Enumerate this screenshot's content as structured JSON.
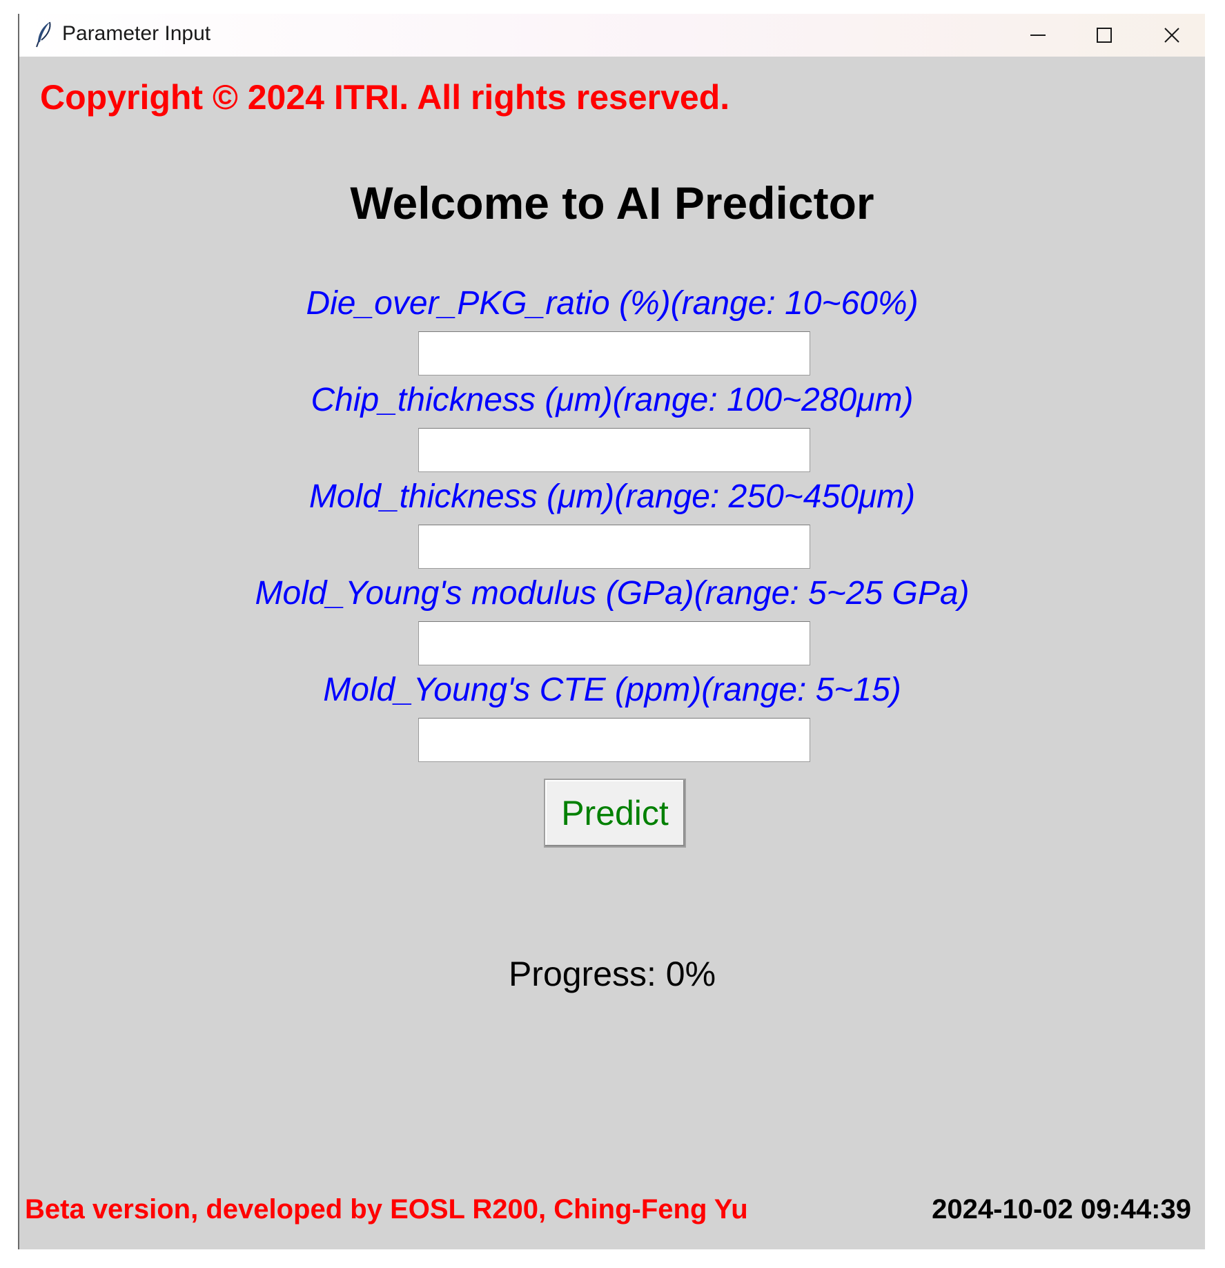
{
  "window": {
    "title": "Parameter Input",
    "icon": "feather-icon",
    "controls": [
      "minimize-icon",
      "maximize-icon",
      "close-icon"
    ]
  },
  "header": {
    "copyright": "Copyright © 2024 ITRI. All rights reserved.",
    "welcome": "Welcome to AI Predictor"
  },
  "parameters": [
    {
      "label": "Die_over_PKG_ratio (%)(range: 10~60%)",
      "value": ""
    },
    {
      "label": "Chip_thickness (μm)(range: 100~280μm)",
      "value": ""
    },
    {
      "label": "Mold_thickness (μm)(range: 250~450μm)",
      "value": ""
    },
    {
      "label": "Mold_Young's modulus (GPa)(range: 5~25 GPa)",
      "value": ""
    },
    {
      "label": "Mold_Young's CTE (ppm)(range: 5~15)",
      "value": ""
    }
  ],
  "predict_button": {
    "label": "Predict"
  },
  "progress": {
    "text": "Progress: 0%",
    "value": 0
  },
  "footer": {
    "credit": "Beta version, developed by EOSL R200, Ching-Feng Yu",
    "timestamp": "2024-10-02 09:44:39"
  },
  "colors": {
    "background": "#d3d3d3",
    "copyright": "#ff0000",
    "param_label": "#0000ff",
    "predict_text": "#008000",
    "footer_credit": "#ff0000"
  }
}
